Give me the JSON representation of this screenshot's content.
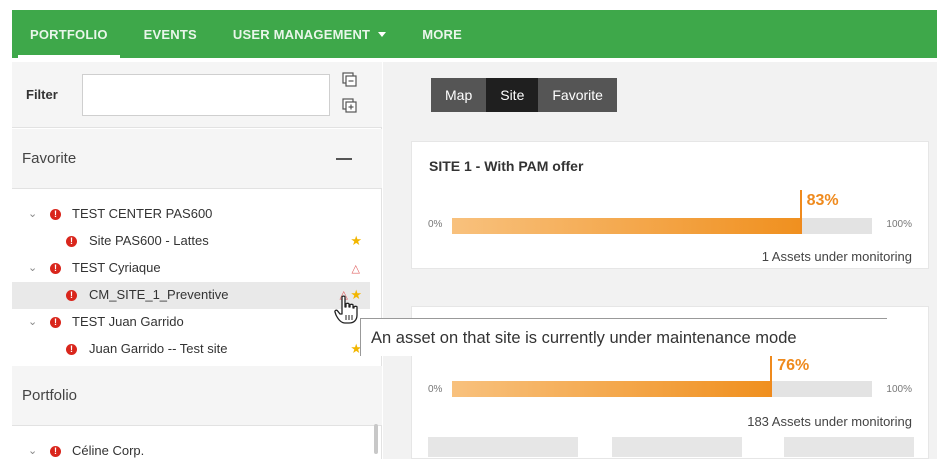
{
  "nav": {
    "items": [
      {
        "label": "PORTFOLIO",
        "active": true
      },
      {
        "label": "EVENTS",
        "active": false
      },
      {
        "label": "USER MANAGEMENT",
        "active": false,
        "dropdown": true
      },
      {
        "label": "MORE",
        "active": false
      }
    ],
    "color": "#3ea84a"
  },
  "filter": {
    "label": "Filter",
    "value": "",
    "icons": [
      "collapse-all-icon",
      "expand-all-icon"
    ]
  },
  "favorite": {
    "title": "Favorite",
    "rows": [
      {
        "label": "TEST CENTER PAS600",
        "level": 0,
        "expanded": true,
        "alert": true,
        "indicator": ""
      },
      {
        "label": "Site PAS600 - Lattes",
        "level": 1,
        "alert": true,
        "indicator": "star"
      },
      {
        "label": "TEST Cyriaque",
        "level": 0,
        "expanded": true,
        "alert": true,
        "indicator": "outline-star"
      },
      {
        "label": "CM_SITE_1_Preventive",
        "level": 1,
        "alert": true,
        "indicator": "star",
        "highlighted": true,
        "extra_icon": "maintenance-icon"
      },
      {
        "label": "TEST Juan Garrido",
        "level": 0,
        "expanded": true,
        "alert": true,
        "indicator": ""
      },
      {
        "label": "Juan Garrido -- Test site",
        "level": 1,
        "alert": true,
        "indicator": "star"
      }
    ]
  },
  "portfolio": {
    "title": "Portfolio",
    "rows": [
      {
        "label": "Céline Corp.",
        "level": 0,
        "expanded": true,
        "alert": true
      }
    ]
  },
  "view_toggle": {
    "options": [
      "Map",
      "Site",
      "Favorite"
    ],
    "selected": "Site"
  },
  "cards": [
    {
      "title": "SITE 1 - With PAM offer",
      "min_label": "0%",
      "max_label": "100%",
      "value": 83,
      "value_label": "83%",
      "assets_label": "1 Assets under monitoring"
    },
    {
      "title": "",
      "min_label": "0%",
      "max_label": "100%",
      "value": 76,
      "value_label": "76%",
      "assets_label": "183 Assets under monitoring"
    }
  ],
  "tooltip": {
    "text": "An asset on that site is currently under maintenance mode"
  },
  "colors": {
    "accent": "#ef8a1d",
    "alert": "#d9261c",
    "star": "#f2b600"
  }
}
